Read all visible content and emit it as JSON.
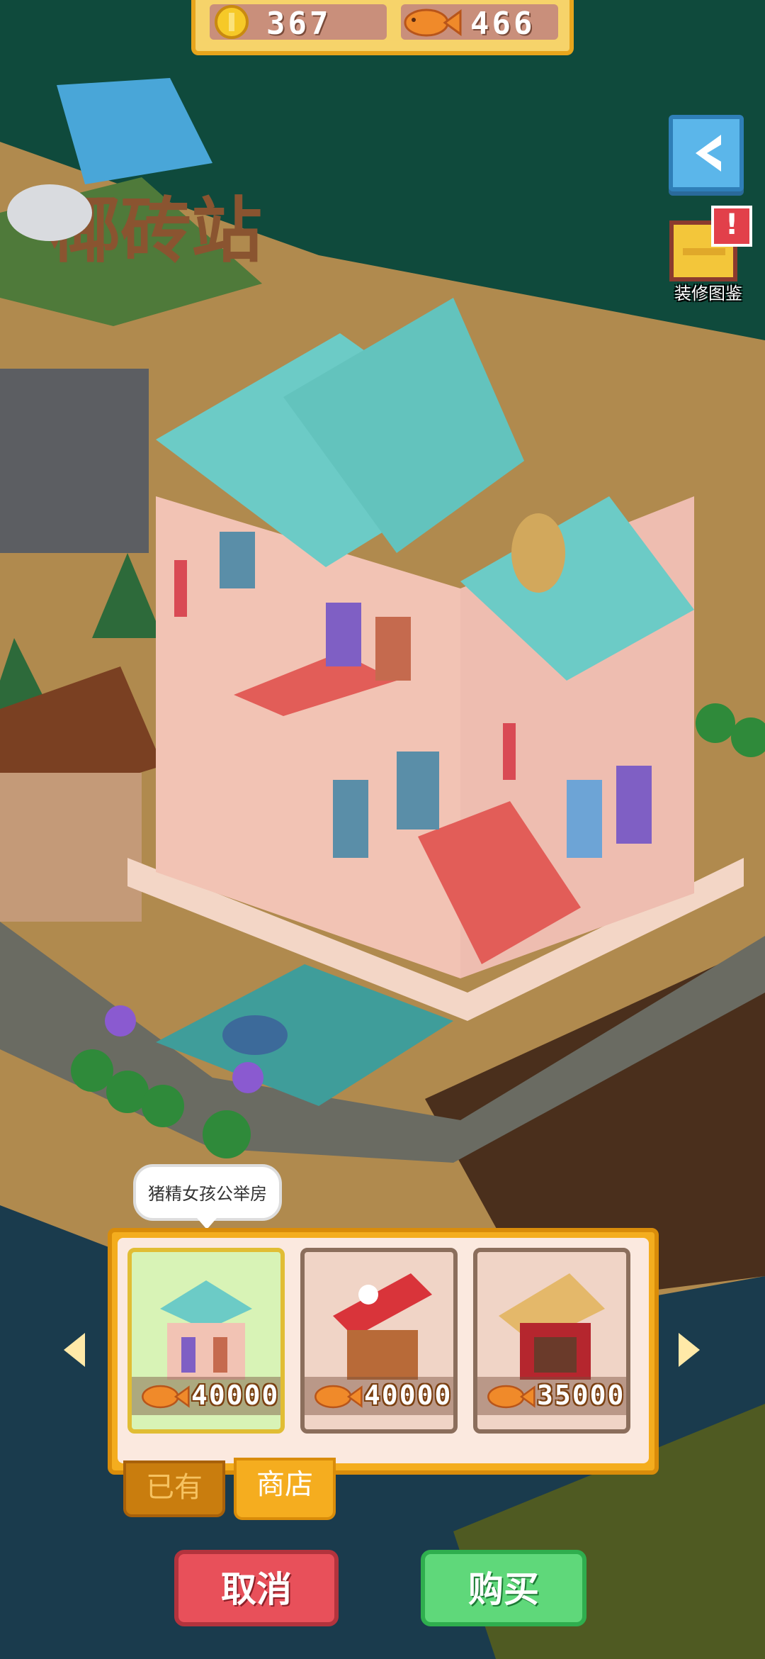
{
  "currency": {
    "coins": "367",
    "fish": "466"
  },
  "sign_text": "椰砖站",
  "catalog": {
    "label": "装修图鉴",
    "alert": "!"
  },
  "tooltip": {
    "text": "猪精女孩公举房"
  },
  "shop": {
    "items": [
      {
        "price": "40000",
        "selected": true
      },
      {
        "price": "40000",
        "selected": false
      },
      {
        "price": "35000",
        "selected": false
      }
    ],
    "tabs": [
      {
        "label": "已有",
        "active": false
      },
      {
        "label": "商店",
        "active": true
      }
    ]
  },
  "actions": {
    "cancel_label": "取消",
    "buy_label": "购买"
  },
  "colors": {
    "accent_gold": "#f4ad1e",
    "cancel_red": "#e8505a",
    "buy_green": "#5fd87a",
    "back_blue": "#5bb6ea"
  },
  "icons": [
    "coin-icon",
    "fish-icon",
    "back-arrow-icon",
    "catalog-book-icon",
    "alert-icon",
    "chevron-left-icon",
    "chevron-right-icon"
  ]
}
